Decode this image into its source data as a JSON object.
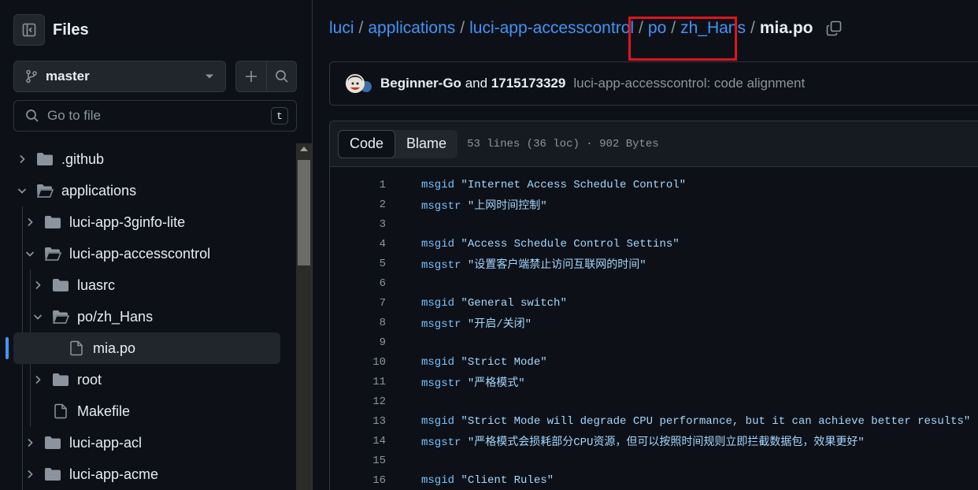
{
  "sidebar": {
    "title": "Files",
    "branch": "master",
    "goto_placeholder": "Go to file",
    "goto_shortcut": "t",
    "tree": [
      {
        "label": ".github",
        "type": "folder",
        "depth": 0,
        "expanded": false
      },
      {
        "label": "applications",
        "type": "folder",
        "depth": 0,
        "expanded": true
      },
      {
        "label": "luci-app-3ginfo-lite",
        "type": "folder",
        "depth": 1,
        "expanded": false
      },
      {
        "label": "luci-app-accesscontrol",
        "type": "folder",
        "depth": 1,
        "expanded": true
      },
      {
        "label": "luasrc",
        "type": "folder",
        "depth": 2,
        "expanded": false
      },
      {
        "label": "po/zh_Hans",
        "type": "folder",
        "depth": 2,
        "expanded": true
      },
      {
        "label": "mia.po",
        "type": "file",
        "depth": 3,
        "active": true
      },
      {
        "label": "root",
        "type": "folder",
        "depth": 2,
        "expanded": false
      },
      {
        "label": "Makefile",
        "type": "file",
        "depth": 2
      },
      {
        "label": "luci-app-acl",
        "type": "folder",
        "depth": 1,
        "expanded": false
      },
      {
        "label": "luci-app-acme",
        "type": "folder",
        "depth": 1,
        "expanded": false
      }
    ]
  },
  "breadcrumb": {
    "links": [
      "luci",
      "applications",
      "luci-app-accesscontrol",
      "po",
      "zh_Hans"
    ],
    "separator": "/",
    "current": "mia.po"
  },
  "commit": {
    "author1": "Beginner-Go",
    "joiner": "and",
    "author2": "1715173329",
    "message": "luci-app-accesscontrol: code alignment"
  },
  "file": {
    "tabs": [
      "Code",
      "Blame"
    ],
    "active_tab": "Code",
    "meta": "53 lines (36 loc) · 902 Bytes",
    "lines": [
      {
        "n": "1",
        "kw": "msgid",
        "str": "\"Internet Access Schedule Control\""
      },
      {
        "n": "2",
        "kw": "msgstr",
        "str": "\"上网时间控制\""
      },
      {
        "n": "3",
        "kw": "",
        "str": ""
      },
      {
        "n": "4",
        "kw": "msgid",
        "str": "\"Access Schedule Control Settins\""
      },
      {
        "n": "5",
        "kw": "msgstr",
        "str": "\"设置客户端禁止访问互联网的时间\""
      },
      {
        "n": "6",
        "kw": "",
        "str": ""
      },
      {
        "n": "7",
        "kw": "msgid",
        "str": "\"General switch\""
      },
      {
        "n": "8",
        "kw": "msgstr",
        "str": "\"开启/关闭\""
      },
      {
        "n": "9",
        "kw": "",
        "str": ""
      },
      {
        "n": "10",
        "kw": "msgid",
        "str": "\"Strict Mode\""
      },
      {
        "n": "11",
        "kw": "msgstr",
        "str": "\"严格模式\""
      },
      {
        "n": "12",
        "kw": "",
        "str": ""
      },
      {
        "n": "13",
        "kw": "msgid",
        "str": "\"Strict Mode will degrade CPU performance, but it can achieve better results\""
      },
      {
        "n": "14",
        "kw": "msgstr",
        "str": "\"严格模式会损耗部分CPU资源，但可以按照时间规则立即拦截数据包，效果更好\""
      },
      {
        "n": "15",
        "kw": "",
        "str": ""
      },
      {
        "n": "16",
        "kw": "msgid",
        "str": "\"Client Rules\""
      }
    ]
  },
  "colors": {
    "accent": "#4493f8",
    "highlight_box": "#e0141e",
    "keyword": "#79c0ff",
    "string": "#a5d6ff"
  },
  "icons": {
    "sidebar_toggle": "sidebar-collapse-icon",
    "branch": "git-branch-icon",
    "add": "plus-icon",
    "search": "search-icon",
    "copy": "copy-icon",
    "folder": "folder-icon",
    "file": "file-icon"
  }
}
